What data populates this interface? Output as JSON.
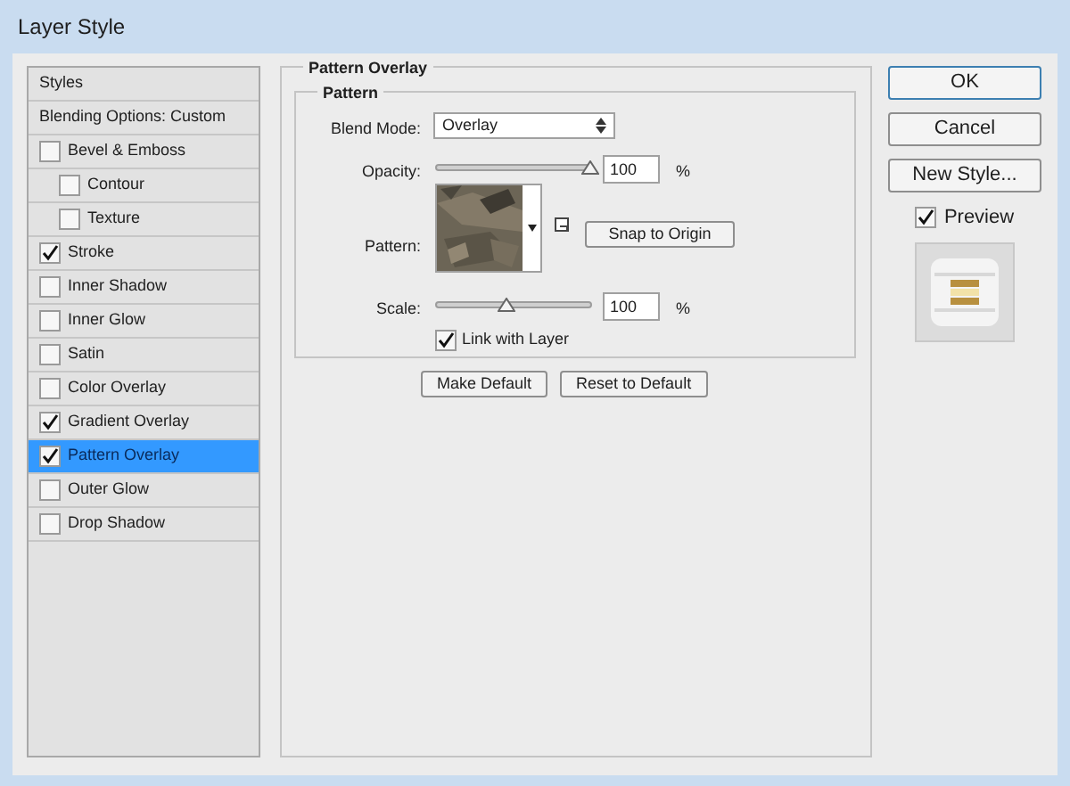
{
  "window": {
    "title": "Layer Style"
  },
  "sidebar": {
    "items": [
      {
        "label": "Styles",
        "kind": "header",
        "selected": false
      },
      {
        "label": "Blending Options: Custom",
        "kind": "header",
        "selected": false
      },
      {
        "label": "Bevel & Emboss",
        "kind": "check",
        "checked": false,
        "selected": false
      },
      {
        "label": "Contour",
        "kind": "subcheck",
        "checked": false,
        "selected": false
      },
      {
        "label": "Texture",
        "kind": "subcheck",
        "checked": false,
        "selected": false
      },
      {
        "label": "Stroke",
        "kind": "check",
        "checked": true,
        "selected": false
      },
      {
        "label": "Inner Shadow",
        "kind": "check",
        "checked": false,
        "selected": false
      },
      {
        "label": "Inner Glow",
        "kind": "check",
        "checked": false,
        "selected": false
      },
      {
        "label": "Satin",
        "kind": "check",
        "checked": false,
        "selected": false
      },
      {
        "label": "Color Overlay",
        "kind": "check",
        "checked": false,
        "selected": false
      },
      {
        "label": "Gradient Overlay",
        "kind": "check",
        "checked": true,
        "selected": false
      },
      {
        "label": "Pattern Overlay",
        "kind": "check",
        "checked": true,
        "selected": true
      },
      {
        "label": "Outer Glow",
        "kind": "check",
        "checked": false,
        "selected": false
      },
      {
        "label": "Drop Shadow",
        "kind": "check",
        "checked": false,
        "selected": false
      }
    ]
  },
  "panel": {
    "title": "Pattern Overlay",
    "group": "Pattern",
    "blend_mode": {
      "label": "Blend Mode:",
      "value": "Overlay"
    },
    "opacity": {
      "label": "Opacity:",
      "level": 1,
      "value": "100",
      "unit": "%"
    },
    "pattern": {
      "label": "Pattern:"
    },
    "snap_button": "Snap to Origin",
    "scale": {
      "label": "Scale:",
      "level": 0.45,
      "value": "100",
      "unit": "%"
    },
    "link": {
      "label": "Link with Layer",
      "checked": true
    },
    "buttons": [
      "Make Default",
      "Reset to Default"
    ]
  },
  "actions": {
    "buttons": [
      "OK",
      "Cancel",
      "New Style..."
    ],
    "preview": {
      "label": "Preview",
      "checked": true
    }
  }
}
